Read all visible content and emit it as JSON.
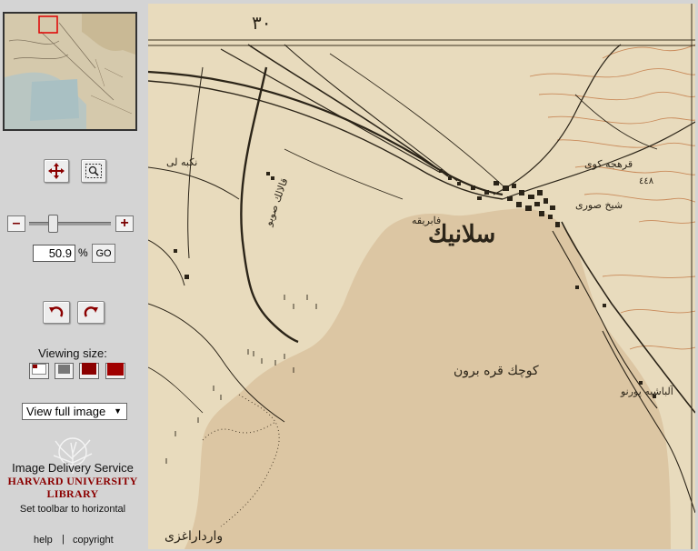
{
  "toolbar": {
    "zoom": {
      "minus_label": "–",
      "plus_label": "+",
      "value": "50.9",
      "percent_label": "%",
      "go_label": "GO",
      "slider_fraction": 0.26
    },
    "viewing_size_label": "Viewing size:",
    "view_select": {
      "selected": "View full image",
      "arrow": "▼"
    },
    "ids_title": "Image Delivery Service",
    "library_line1": "HARVARD UNIVERSITY",
    "library_line2": "LIBRARY",
    "set_toolbar_label": "Set toolbar to horizontal",
    "help_label": "help",
    "separator": "|",
    "copyright_label": "copyright"
  },
  "map_labels": {
    "city": "سلانيك",
    "area": "كوچك قره برون",
    "lake": "وارداراغزى",
    "sheet_number": "٣٠",
    "hamlet": "نكبه لى",
    "farm": "فابريقه",
    "rail": "قالالك صوبو",
    "east": "قرهجه كوى",
    "south": "شيخ صورى",
    "coast": "آلباشيه پورنو",
    "height": "٤٤٨"
  },
  "colors": {
    "accent": "#8b0000",
    "paper": "#e6d8ba",
    "water": "#d9c4a2",
    "ink": "#2b2418",
    "contour": "#c98a5a"
  }
}
